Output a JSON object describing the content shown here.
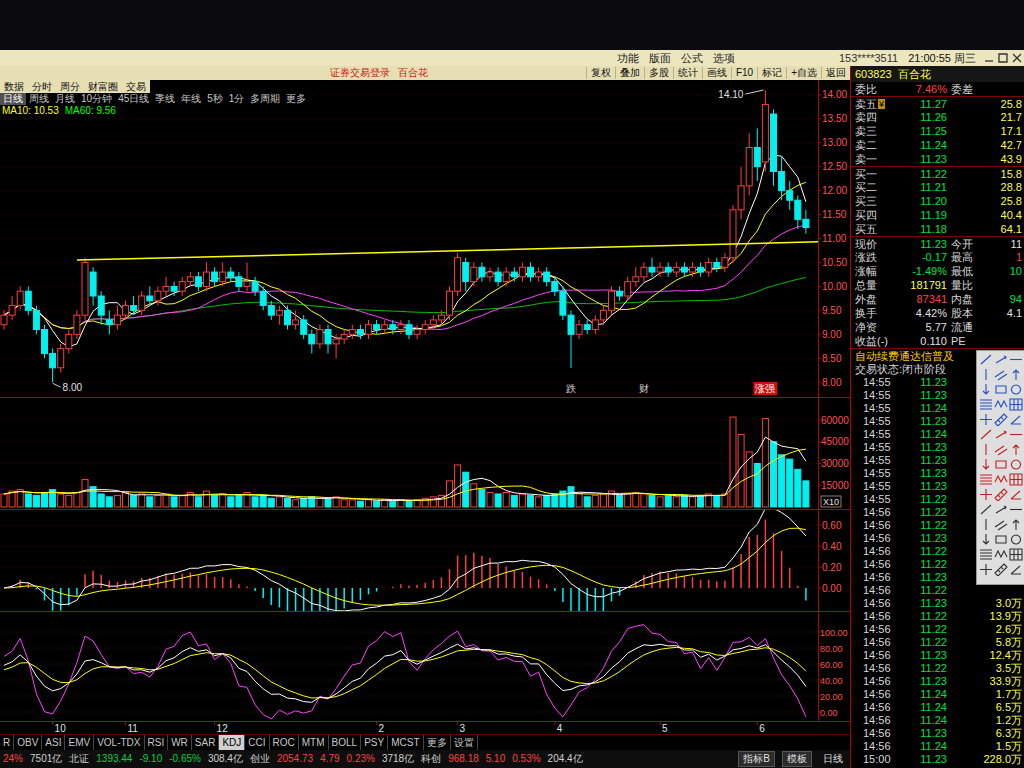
{
  "menubar": {
    "menus": [
      "功能",
      "版面",
      "公式",
      "选项"
    ],
    "user": "153****3511",
    "clock": "21:00:55 周三"
  },
  "titlebar": {
    "title": "证券交易登录",
    "stock": "百合花",
    "buttons": [
      "复权",
      "叠加",
      "多股",
      "统计",
      "画线",
      "F10",
      "标记",
      "+自选",
      "返回"
    ]
  },
  "nav_tabs": [
    "数据",
    "分时",
    "周分",
    "财富圈",
    "交易"
  ],
  "periods": [
    {
      "label": "日线",
      "selected": true
    },
    {
      "label": "周线",
      "selected": false
    },
    {
      "label": "月线",
      "selected": false
    },
    {
      "label": "10分钟",
      "selected": false
    },
    {
      "label": "45日线",
      "selected": false
    },
    {
      "label": "季线",
      "selected": false
    },
    {
      "label": "年线",
      "selected": false
    },
    {
      "label": "5秒",
      "selected": false
    },
    {
      "label": "1分",
      "selected": false
    },
    {
      "label": "多周期",
      "selected": false
    },
    {
      "label": "更多",
      "selected": false
    }
  ],
  "legend": [
    {
      "text": "MA10: 10.53",
      "color": "#ffff00"
    },
    {
      "text": "MA60: 9.56",
      "color": "#00ff00"
    }
  ],
  "price_chart": {
    "axis": [
      {
        "text": "14.00",
        "value": 14
      },
      {
        "text": "13.50",
        "value": 13.5
      },
      {
        "text": "13.00",
        "value": 13
      },
      {
        "text": "12.50",
        "value": 12.5
      },
      {
        "text": "12.00",
        "value": 12
      },
      {
        "text": "11.50",
        "value": 11.5
      },
      {
        "text": "11.00",
        "value": 11
      },
      {
        "text": "10.50",
        "value": 10.5
      },
      {
        "text": "10.00",
        "value": 10
      },
      {
        "text": "9.50",
        "value": 9.5
      },
      {
        "text": "9.00",
        "value": 9
      },
      {
        "text": "8.50",
        "value": 8.5
      },
      {
        "text": "8.00",
        "value": 8
      }
    ],
    "candles": [
      [
        9.2,
        9.4,
        9.5,
        9.1
      ],
      [
        9.4,
        9.6,
        9.8,
        9.3
      ],
      [
        9.6,
        9.9,
        10.0,
        9.5
      ],
      [
        9.9,
        9.5,
        10.0,
        9.4
      ],
      [
        9.5,
        9.1,
        9.6,
        9.0
      ],
      [
        9.1,
        8.6,
        9.2,
        8.5
      ],
      [
        8.6,
        8.3,
        8.7,
        8.0
      ],
      [
        8.3,
        8.7,
        8.8,
        8.2
      ],
      [
        8.7,
        9.0,
        9.1,
        8.6
      ],
      [
        9.0,
        9.4,
        9.5,
        8.9
      ],
      [
        9.4,
        10.5,
        10.6,
        9.3
      ],
      [
        10.3,
        9.8,
        10.4,
        9.6
      ],
      [
        9.8,
        9.4,
        9.9,
        9.2
      ],
      [
        9.3,
        9.2,
        9.5,
        9.0
      ],
      [
        9.2,
        9.4,
        9.6,
        9.1
      ],
      [
        9.4,
        9.6,
        9.7,
        9.3
      ],
      [
        9.6,
        9.5,
        9.8,
        9.4
      ],
      [
        9.5,
        9.8,
        9.9,
        9.4
      ],
      [
        9.8,
        9.7,
        10.0,
        9.6
      ],
      [
        9.7,
        9.9,
        10.0,
        9.6
      ],
      [
        9.9,
        10.0,
        10.2,
        9.8
      ],
      [
        10.0,
        9.9,
        10.1,
        9.8
      ],
      [
        9.9,
        10.1,
        10.2,
        9.8
      ],
      [
        10.1,
        10.2,
        10.3,
        10.0
      ],
      [
        10.2,
        10.0,
        10.3,
        9.9
      ],
      [
        10.0,
        10.3,
        10.5,
        9.9
      ],
      [
        10.3,
        10.1,
        10.4,
        10.0
      ],
      [
        10.1,
        10.3,
        10.5,
        10.0
      ],
      [
        10.3,
        10.2,
        10.4,
        10.1
      ],
      [
        10.2,
        10.0,
        10.3,
        9.9
      ],
      [
        10.0,
        10.1,
        10.5,
        9.9
      ],
      [
        10.1,
        9.9,
        10.2,
        9.8
      ],
      [
        9.9,
        9.6,
        10.0,
        9.5
      ],
      [
        9.6,
        9.4,
        9.7,
        9.3
      ],
      [
        9.4,
        9.5,
        9.6,
        9.2
      ],
      [
        9.5,
        9.2,
        9.6,
        9.1
      ],
      [
        9.2,
        9.3,
        9.5,
        9.1
      ],
      [
        9.3,
        9.0,
        9.4,
        8.9
      ],
      [
        9.0,
        8.8,
        9.1,
        8.6
      ],
      [
        8.8,
        9.1,
        9.2,
        8.7
      ],
      [
        9.1,
        8.8,
        9.2,
        8.6
      ],
      [
        8.8,
        8.9,
        9.0,
        8.5
      ],
      [
        8.9,
        9.0,
        9.1,
        8.8
      ],
      [
        9.0,
        9.1,
        9.2,
        8.9
      ],
      [
        9.1,
        9.0,
        9.2,
        8.9
      ],
      [
        9.0,
        9.2,
        9.3,
        8.9
      ],
      [
        9.2,
        9.1,
        9.3,
        9.0
      ],
      [
        9.1,
        9.2,
        9.3,
        9.0
      ],
      [
        9.2,
        9.1,
        9.3,
        9.0
      ],
      [
        9.1,
        9.2,
        9.3,
        9.0
      ],
      [
        9.2,
        9.0,
        9.3,
        8.9
      ],
      [
        9.0,
        9.1,
        9.2,
        8.9
      ],
      [
        9.1,
        9.2,
        9.3,
        9.0
      ],
      [
        9.2,
        9.3,
        9.4,
        9.1
      ],
      [
        9.3,
        9.4,
        9.5,
        9.2
      ],
      [
        9.4,
        9.9,
        10.0,
        9.3
      ],
      [
        9.9,
        10.6,
        10.7,
        9.8
      ],
      [
        10.5,
        10.1,
        10.6,
        9.9
      ],
      [
        10.1,
        10.4,
        10.5,
        10.0
      ],
      [
        10.4,
        10.2,
        10.5,
        10.1
      ],
      [
        10.2,
        10.3,
        10.4,
        10.1
      ],
      [
        10.3,
        10.1,
        10.4,
        10.0
      ],
      [
        10.1,
        10.3,
        10.4,
        10.0
      ],
      [
        10.3,
        10.2,
        10.4,
        10.1
      ],
      [
        10.2,
        10.4,
        10.5,
        10.1
      ],
      [
        10.4,
        10.2,
        10.5,
        10.1
      ],
      [
        10.2,
        10.3,
        10.4,
        10.1
      ],
      [
        10.3,
        10.1,
        10.4,
        10.0
      ],
      [
        10.1,
        9.9,
        10.2,
        9.8
      ],
      [
        9.9,
        9.4,
        10.0,
        9.3
      ],
      [
        9.4,
        9.0,
        9.5,
        8.3
      ],
      [
        9.0,
        9.2,
        9.3,
        8.9
      ],
      [
        9.2,
        9.1,
        9.3,
        9.0
      ],
      [
        9.1,
        9.3,
        9.4,
        9.0
      ],
      [
        9.3,
        9.5,
        9.6,
        9.2
      ],
      [
        9.5,
        9.9,
        10.0,
        9.4
      ],
      [
        9.9,
        9.8,
        10.0,
        9.7
      ],
      [
        9.8,
        10.1,
        10.2,
        9.7
      ],
      [
        10.1,
        10.2,
        10.4,
        10.0
      ],
      [
        10.2,
        10.4,
        10.5,
        10.1
      ],
      [
        10.4,
        10.3,
        10.6,
        10.2
      ],
      [
        10.3,
        10.4,
        10.5,
        10.2
      ],
      [
        10.4,
        10.3,
        10.5,
        10.2
      ],
      [
        10.3,
        10.4,
        10.5,
        10.2
      ],
      [
        10.4,
        10.3,
        10.5,
        10.2
      ],
      [
        10.3,
        10.4,
        10.5,
        10.2
      ],
      [
        10.4,
        10.3,
        10.5,
        10.2
      ],
      [
        10.3,
        10.5,
        10.6,
        10.2
      ],
      [
        10.5,
        10.4,
        10.6,
        10.3
      ],
      [
        10.4,
        10.6,
        10.7,
        10.3
      ],
      [
        10.6,
        11.6,
        11.7,
        10.5
      ],
      [
        11.6,
        12.1,
        12.5,
        11.4
      ],
      [
        12.1,
        12.9,
        13.2,
        11.9
      ],
      [
        12.9,
        12.5,
        13.3,
        12.2
      ],
      [
        12.6,
        13.8,
        14.1,
        12.4
      ],
      [
        13.6,
        12.4,
        13.7,
        12.1
      ],
      [
        12.4,
        12.0,
        12.7,
        11.8
      ],
      [
        12.0,
        11.8,
        12.2,
        11.6
      ],
      [
        11.8,
        11.4,
        11.9,
        11.2
      ],
      [
        11.4,
        11.23,
        11.6,
        11.1
      ]
    ],
    "trendline": {
      "from": [
        9,
        10.55
      ],
      "to": [
        100.5,
        10.93
      ]
    },
    "high_label": {
      "text": "14.10",
      "index": 94,
      "value": 14.1
    },
    "low_label": {
      "text": "8.00",
      "index": 6,
      "value": 8.0
    },
    "markers": [
      {
        "text": "跌",
        "index": 70,
        "kind": "plain"
      },
      {
        "text": "财",
        "index": 79,
        "kind": "plain"
      },
      {
        "text": "涨强",
        "index": 94,
        "kind": "badge"
      }
    ]
  },
  "volume_chart": {
    "axis": [
      {
        "text": "60000",
        "value": 60000
      },
      {
        "text": "45000",
        "value": 45000
      },
      {
        "text": "30000",
        "value": 30000
      },
      {
        "text": "15000",
        "value": 15000
      }
    ],
    "unit": "X10",
    "values": [
      9000,
      11000,
      12000,
      9000,
      8000,
      10000,
      12000,
      9000,
      8000,
      10000,
      19000,
      14000,
      9000,
      7000,
      8000,
      10000,
      8000,
      9000,
      7000,
      8000,
      9000,
      7000,
      8000,
      10000,
      7000,
      11000,
      8000,
      9000,
      7000,
      8000,
      10000,
      7000,
      8000,
      6000,
      7000,
      6000,
      5000,
      6000,
      7000,
      6000,
      6000,
      7000,
      5000,
      5000,
      4000,
      5000,
      4000,
      5000,
      4000,
      5000,
      4000,
      5000,
      6000,
      7000,
      8000,
      18000,
      29000,
      24000,
      16000,
      12000,
      10000,
      9000,
      10000,
      8000,
      9000,
      8000,
      7000,
      8000,
      9000,
      11000,
      14000,
      9000,
      7000,
      8000,
      9000,
      11000,
      8000,
      9000,
      10000,
      9000,
      8000,
      7000,
      8000,
      7000,
      8000,
      7000,
      8000,
      9000,
      8000,
      9000,
      62000,
      50000,
      38000,
      30000,
      61000,
      45000,
      36000,
      33000,
      26000,
      18000
    ]
  },
  "macd_chart": {
    "axis": [
      {
        "text": "0.60",
        "value": 0.6
      },
      {
        "text": "0.40",
        "value": 0.4
      },
      {
        "text": "0.20",
        "value": 0.2
      },
      {
        "text": "0.00",
        "value": 0
      }
    ]
  },
  "kdj_chart": {
    "axis": [
      {
        "text": "100.00",
        "value": 100
      },
      {
        "text": "80.00",
        "value": 80
      },
      {
        "text": "60.00",
        "value": 60
      },
      {
        "text": "40.00",
        "value": 40
      },
      {
        "text": "20.00",
        "value": 20
      },
      {
        "text": "0.00",
        "value": 0
      }
    ]
  },
  "dates": [
    {
      "text": "10",
      "index": 6
    },
    {
      "text": "11",
      "index": 15
    },
    {
      "text": "12",
      "index": 26
    },
    {
      "text": "2",
      "index": 46
    },
    {
      "text": "3",
      "index": 56
    },
    {
      "text": "4",
      "index": 68
    },
    {
      "text": "5",
      "index": 81
    },
    {
      "text": "6",
      "index": 93
    }
  ],
  "indicator_tabs": [
    {
      "label": "R",
      "selected": false
    },
    {
      "label": "OBV",
      "selected": false
    },
    {
      "label": "ASI",
      "selected": false
    },
    {
      "label": "EMV",
      "selected": false
    },
    {
      "label": "VOL-TDX",
      "selected": false
    },
    {
      "label": "RSI",
      "selected": false
    },
    {
      "label": "WR",
      "selected": false
    },
    {
      "label": "SAR",
      "selected": false
    },
    {
      "label": "KDJ",
      "selected": true
    },
    {
      "label": "CCI",
      "selected": false
    },
    {
      "label": "ROC",
      "selected": false
    },
    {
      "label": "MTM",
      "selected": false
    },
    {
      "label": "BOLL",
      "selected": false
    },
    {
      "label": "PSY",
      "selected": false
    },
    {
      "label": "MCST",
      "selected": false
    },
    {
      "label": "更多",
      "selected": false
    },
    {
      "label": "设置",
      "selected": false
    }
  ],
  "status_bar": {
    "items": [
      {
        "text": "24%",
        "color": "#ff4040"
      },
      {
        "text": "7501亿",
        "color": "#d0d0d0"
      },
      {
        "text": "北证",
        "color": "#d0d0d0"
      },
      {
        "text": "1393.44",
        "color": "#00d040"
      },
      {
        "text": "-9.10",
        "color": "#00d040"
      },
      {
        "text": "-0.65%",
        "color": "#00d040"
      },
      {
        "text": "308.4亿",
        "color": "#d0d0d0"
      },
      {
        "text": "创业",
        "color": "#d0d0d0"
      },
      {
        "text": "2054.73",
        "color": "#ff4040"
      },
      {
        "text": "4.79",
        "color": "#ff4040"
      },
      {
        "text": "0.23%",
        "color": "#ff4040"
      },
      {
        "text": "3718亿",
        "color": "#d0d0d0"
      },
      {
        "text": "科创",
        "color": "#d0d0d0"
      },
      {
        "text": "968.18",
        "color": "#ff4040"
      },
      {
        "text": "5.10",
        "color": "#ff4040"
      },
      {
        "text": "0.53%",
        "color": "#ff4040"
      },
      {
        "text": "204.4亿",
        "color": "#d0d0d0"
      }
    ],
    "buttons": [
      "指标B",
      "模板"
    ],
    "period": "日线"
  },
  "quote": {
    "code": "603823",
    "name": "百合花",
    "ratio": {
      "label": "委比",
      "value": "7.46%",
      "label2": "委差"
    },
    "asks": [
      {
        "label": "卖五",
        "badge": "¥",
        "price": "11.27",
        "volume": "25.8"
      },
      {
        "label": "卖四",
        "price": "11.26",
        "volume": "21.7"
      },
      {
        "label": "卖三",
        "price": "11.25",
        "volume": "17.1"
      },
      {
        "label": "卖二",
        "price": "11.24",
        "volume": "42.7"
      },
      {
        "label": "卖一",
        "price": "11.23",
        "volume": "43.9"
      }
    ],
    "bids": [
      {
        "label": "买一",
        "price": "11.22",
        "volume": "15.8"
      },
      {
        "label": "买二",
        "price": "11.21",
        "volume": "28.8"
      },
      {
        "label": "买三",
        "price": "11.20",
        "volume": "25.8"
      },
      {
        "label": "买四",
        "price": "11.19",
        "volume": "40.4"
      },
      {
        "label": "买五",
        "price": "11.18",
        "volume": "64.1"
      }
    ],
    "stats": [
      {
        "label": "现价",
        "value": "11.23",
        "color": "#00e040",
        "label2": "今开",
        "value2": "11",
        "color2": "#e0e0e0"
      },
      {
        "label": "涨跌",
        "value": "-0.17",
        "color": "#00e040",
        "label2": "最高",
        "value2": "1",
        "color2": "#ff4040"
      },
      {
        "label": "涨幅",
        "value": "-1.49%",
        "color": "#00e040",
        "label2": "最低",
        "value2": "10",
        "color2": "#00e040"
      },
      {
        "label": "总量",
        "value": "181791",
        "color": "#ffff40",
        "label2": "量比"
      },
      {
        "label": "外盘",
        "value": "87341",
        "color": "#ff4040",
        "label2": "内盘",
        "value2": "94",
        "color2": "#00e040"
      },
      {
        "label": "换手",
        "value": "4.42%",
        "color": "#e0e0e0",
        "label2": "股本",
        "value2": "4.1",
        "color2": "#e0e0e0"
      },
      {
        "label": "净资",
        "value": "5.77",
        "color": "#e0e0e0",
        "label2": "流通"
      },
      {
        "label": "收益(-)",
        "value": "0.110",
        "color": "#e0e0e0",
        "label2": "PE"
      }
    ],
    "notice": "自动续费通达信普及",
    "trade_status": "交易状态:闭市阶段",
    "trades": [
      {
        "time": "14:55",
        "price": "11.23"
      },
      {
        "time": "14:55",
        "price": "11.23"
      },
      {
        "time": "14:55",
        "price": "11.24"
      },
      {
        "time": "14:55",
        "price": "11.23"
      },
      {
        "time": "14:55",
        "price": "11.24"
      },
      {
        "time": "14:55",
        "price": "11.23"
      },
      {
        "time": "14:55",
        "price": "11.23"
      },
      {
        "time": "14:55",
        "price": "11.23"
      },
      {
        "time": "14:55",
        "price": "11.23"
      },
      {
        "time": "14:55",
        "price": "11.22"
      },
      {
        "time": "14:56",
        "price": "11.22"
      },
      {
        "time": "14:56",
        "price": "11.22"
      },
      {
        "time": "14:56",
        "price": "11.23"
      },
      {
        "time": "14:56",
        "price": "11.22"
      },
      {
        "time": "14:56",
        "price": "11.22"
      },
      {
        "time": "14:56",
        "price": "11.23"
      },
      {
        "time": "14:56",
        "price": "11.22"
      },
      {
        "time": "14:56",
        "price": "11.23",
        "volume": "3.0万"
      },
      {
        "time": "14:56",
        "price": "11.22",
        "volume": "13.9万"
      },
      {
        "time": "14:56",
        "price": "11.22",
        "volume": "2.6万"
      },
      {
        "time": "14:56",
        "price": "11.22",
        "volume": "5.8万"
      },
      {
        "time": "14:56",
        "price": "11.23",
        "volume": "12.4万"
      },
      {
        "time": "14:56",
        "price": "11.22",
        "volume": "3.5万"
      },
      {
        "time": "14:56",
        "price": "11.23",
        "volume": "33.9万"
      },
      {
        "time": "14:56",
        "price": "11.24",
        "volume": "1.7万"
      },
      {
        "time": "14:56",
        "price": "11.24",
        "volume": "6.5万"
      },
      {
        "time": "14:56",
        "price": "11.24",
        "volume": "1.2万"
      },
      {
        "time": "14:56",
        "price": "11.23",
        "volume": "6.3万"
      },
      {
        "time": "14:56",
        "price": "11.24",
        "volume": "1.5万"
      },
      {
        "time": "15:00",
        "price": "11.23",
        "volume": "228.0万"
      }
    ]
  }
}
